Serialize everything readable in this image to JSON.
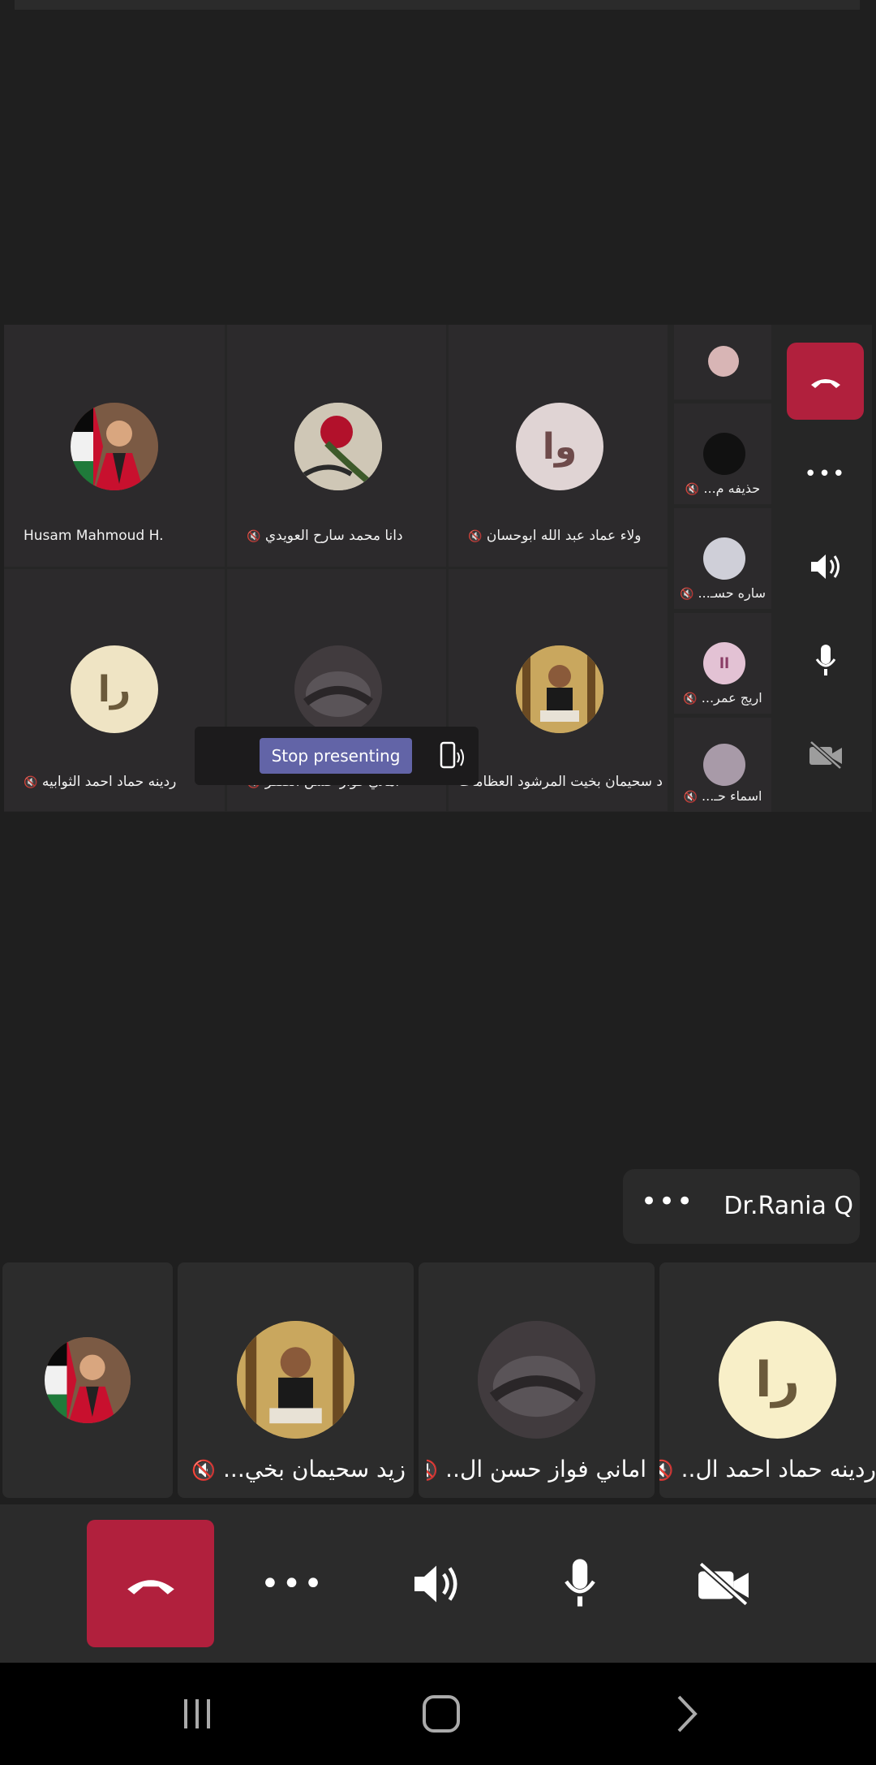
{
  "shared_screen": {
    "grid_tiles": [
      {
        "name": "Husam Mahmoud H.",
        "muted": false
      },
      {
        "name": "دانا محمد سارح العويدي",
        "muted": true
      },
      {
        "name": "ولاء عماد عبد الله ابوحسان",
        "muted": true,
        "initials": "وا"
      },
      {
        "name": "ردينه حماد احمد الثوابيه",
        "muted": true,
        "initials": "را"
      },
      {
        "name": "اماني فواز حسن الصقر",
        "muted": true
      },
      {
        "name": "د سحيمان بخيت المرشود العظامات",
        "muted": false
      }
    ],
    "side_tiles": [
      {
        "name": "",
        "muted": false
      },
      {
        "name": "حذيفه م...",
        "muted": true
      },
      {
        "name": "ساره حسـ...",
        "muted": true
      },
      {
        "name": "اريج عمر...",
        "muted": true,
        "initials": "اا"
      },
      {
        "name": "اسماء حـ...",
        "muted": true
      }
    ],
    "stop_presenting_label": "Stop presenting"
  },
  "presenter": {
    "name": "Dr.Rania Q",
    "more_label": "•••"
  },
  "participant_strip": [
    {
      "name": "",
      "muted": false
    },
    {
      "name": "زيد سحيمان بخي...",
      "muted": true
    },
    {
      "name": "اماني فواز حسن ال..",
      "muted": true
    },
    {
      "name": "ردينه حماد احمد ال..",
      "muted": true,
      "initials": "را"
    }
  ],
  "controls": {
    "more_label": "•••"
  },
  "colors": {
    "hangup": "#b1203d",
    "accent": "#6264a7",
    "background": "#1f1f1f"
  }
}
